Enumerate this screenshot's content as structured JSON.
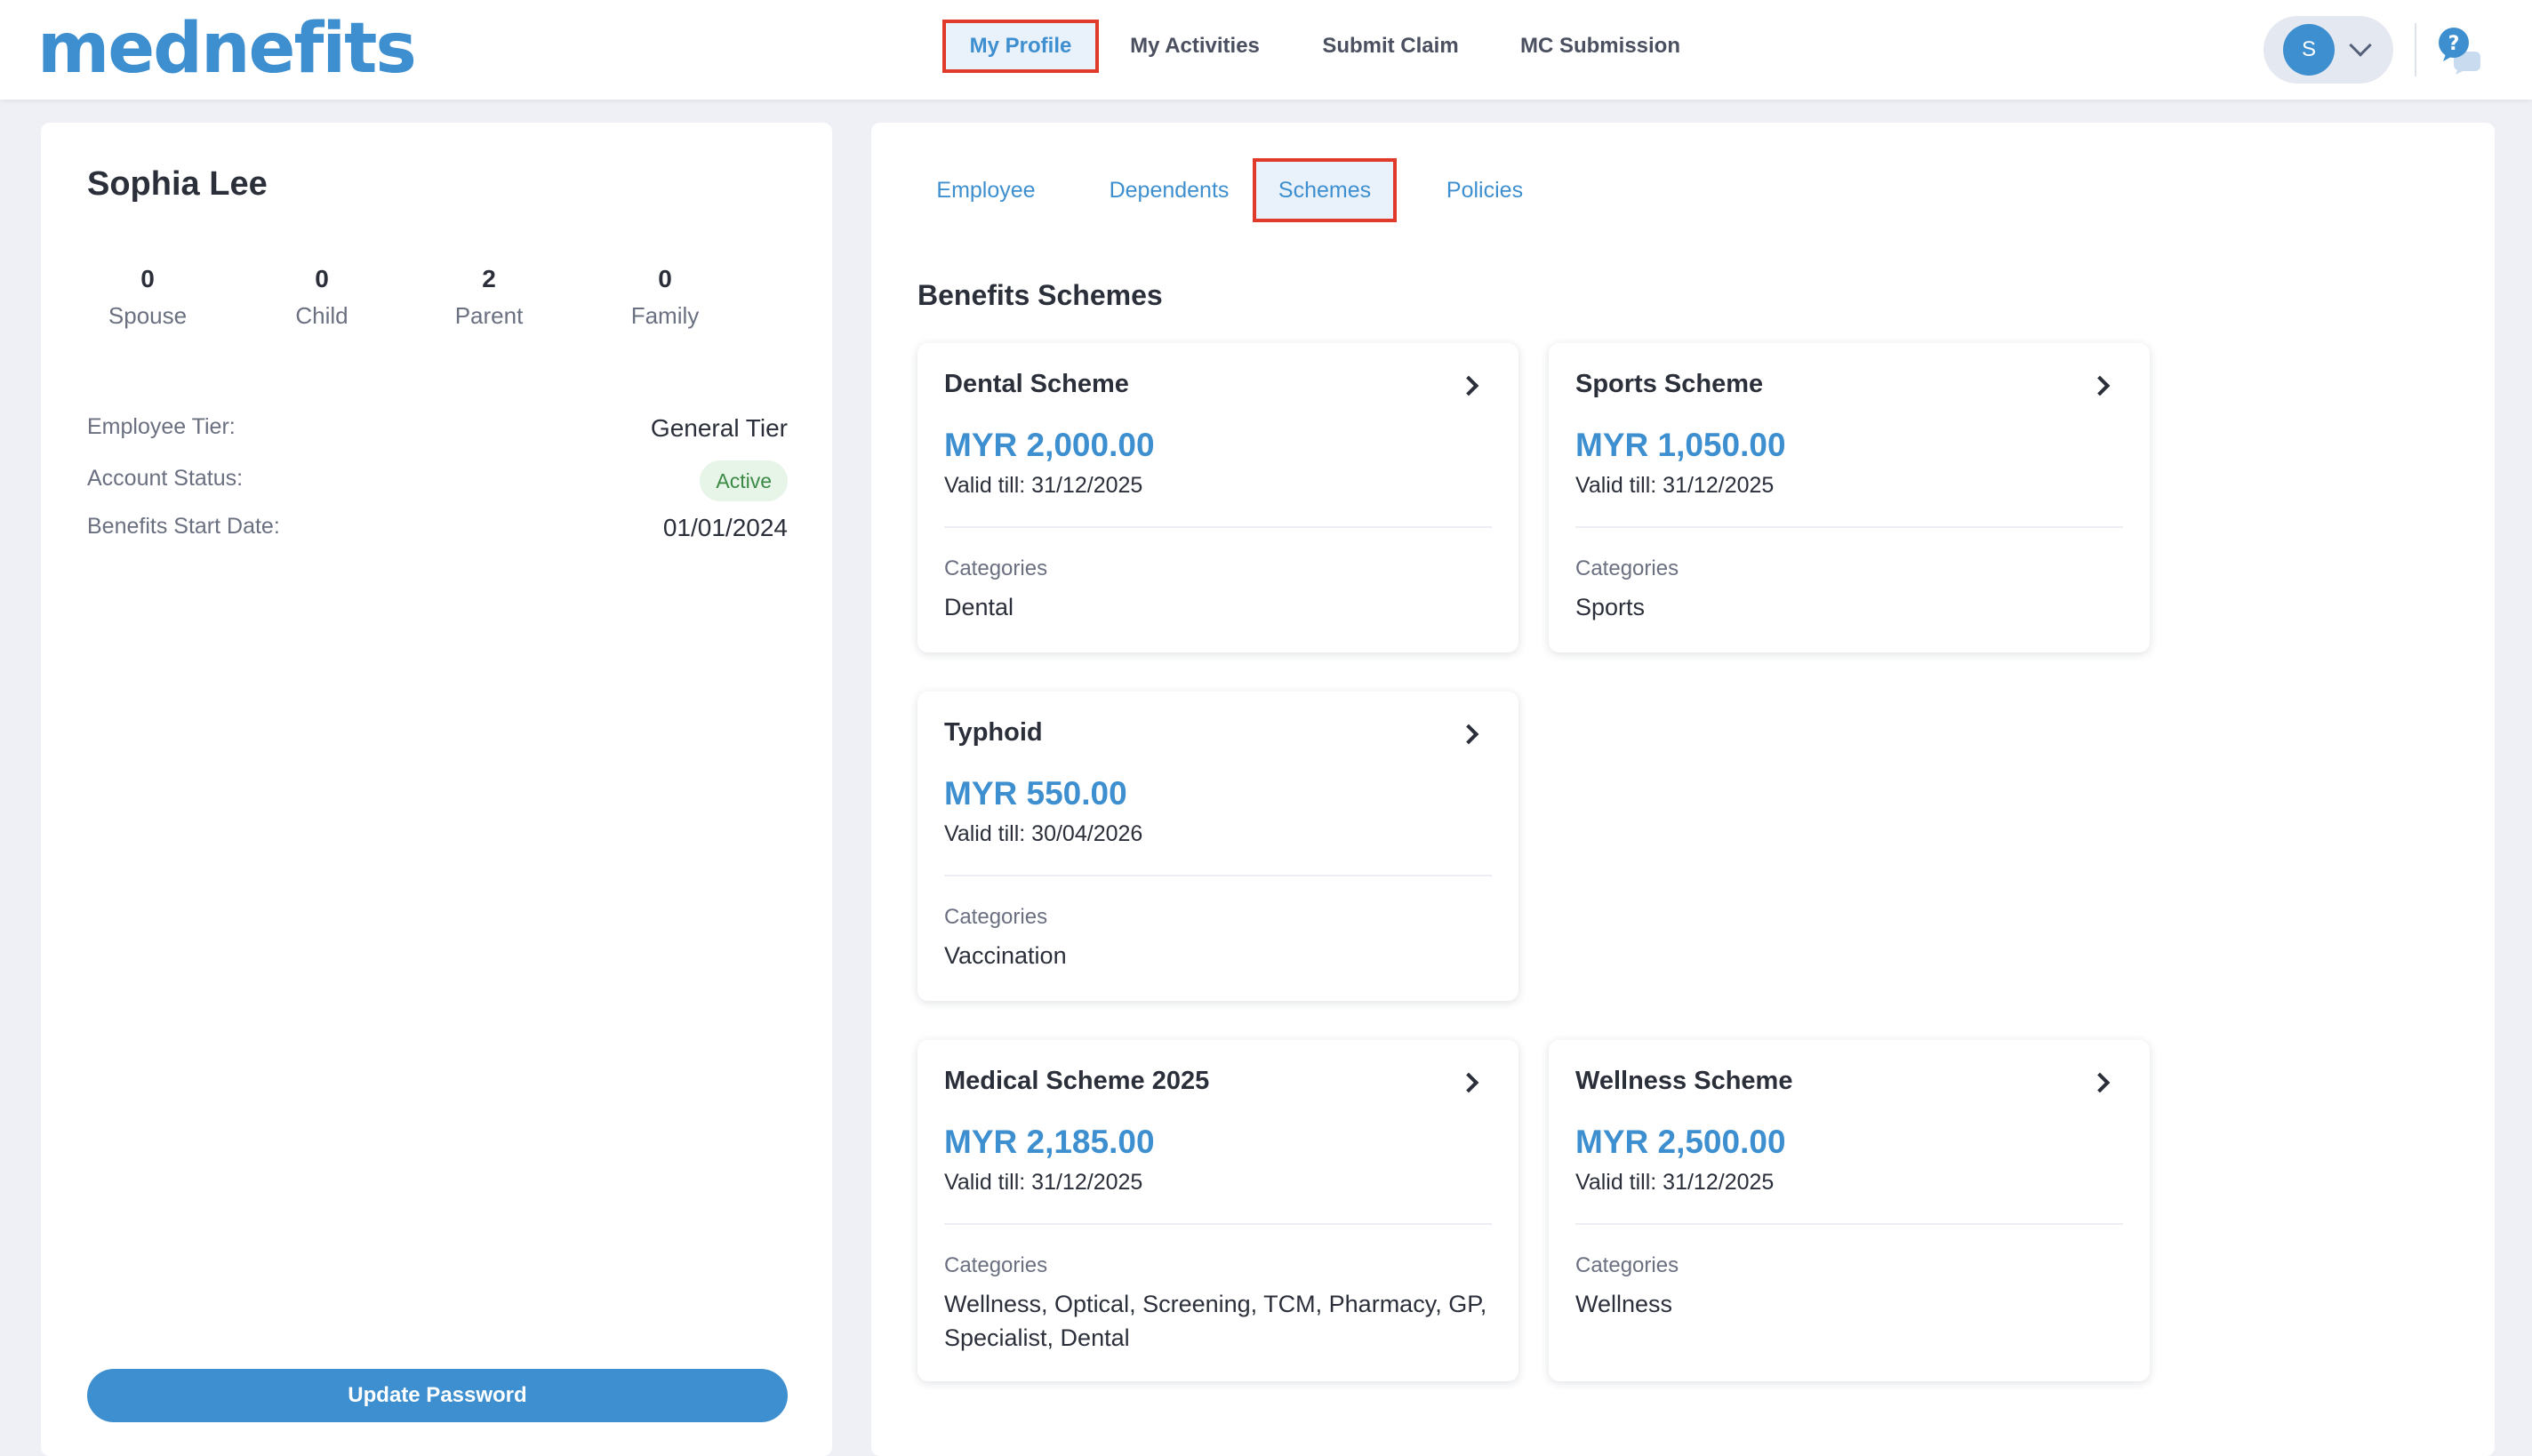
{
  "header": {
    "logo_text": "mednefits",
    "nav": [
      {
        "label": "My Profile",
        "active": true
      },
      {
        "label": "My Activities",
        "active": false
      },
      {
        "label": "Submit Claim",
        "active": false
      },
      {
        "label": "MC Submission",
        "active": false
      }
    ],
    "user_initial": "S",
    "help_symbol": "?"
  },
  "profile": {
    "name": "Sophia Lee",
    "stats": [
      {
        "value": "0",
        "label": "Spouse"
      },
      {
        "value": "0",
        "label": "Child"
      },
      {
        "value": "2",
        "label": "Parent"
      },
      {
        "value": "0",
        "label": "Family"
      }
    ],
    "tier_label": "Employee Tier:",
    "tier_value": "General Tier",
    "status_label": "Account Status:",
    "status_value": "Active",
    "start_label": "Benefits Start Date:",
    "start_value": "01/01/2024",
    "update_password_label": "Update Password"
  },
  "tabs": [
    {
      "label": "Employee",
      "active": false
    },
    {
      "label": "Dependents",
      "active": false
    },
    {
      "label": "Schemes",
      "active": true
    },
    {
      "label": "Policies",
      "active": false
    }
  ],
  "section_title": "Benefits Schemes",
  "schemes": [
    {
      "name": "Dental Scheme",
      "amount": "MYR 2,000.00",
      "valid": "Valid till: 31/12/2025",
      "categories_label": "Categories",
      "categories": "Dental"
    },
    {
      "name": "Sports Scheme",
      "amount": "MYR 1,050.00",
      "valid": "Valid till: 31/12/2025",
      "categories_label": "Categories",
      "categories": "Sports"
    },
    {
      "name": "Typhoid",
      "amount": "MYR 550.00",
      "valid": "Valid till: 30/04/2026",
      "categories_label": "Categories",
      "categories": "Vaccination"
    },
    {
      "name": "Medical Scheme 2025",
      "amount": "MYR 2,185.00",
      "valid": "Valid till: 31/12/2025",
      "categories_label": "Categories",
      "categories": "Wellness, Optical, Screening, TCM, Pharmacy, GP, Specialist, Dental"
    },
    {
      "name": "Wellness Scheme",
      "amount": "MYR 2,500.00",
      "valid": "Valid till: 31/12/2025",
      "categories_label": "Categories",
      "categories": "Wellness"
    }
  ],
  "colors": {
    "accent": "#3d8fcf",
    "highlight_border": "#e03a2a",
    "active_badge_bg": "#e7f4e8",
    "active_badge_text": "#3a8a46",
    "page_bg": "#eef0f6"
  }
}
